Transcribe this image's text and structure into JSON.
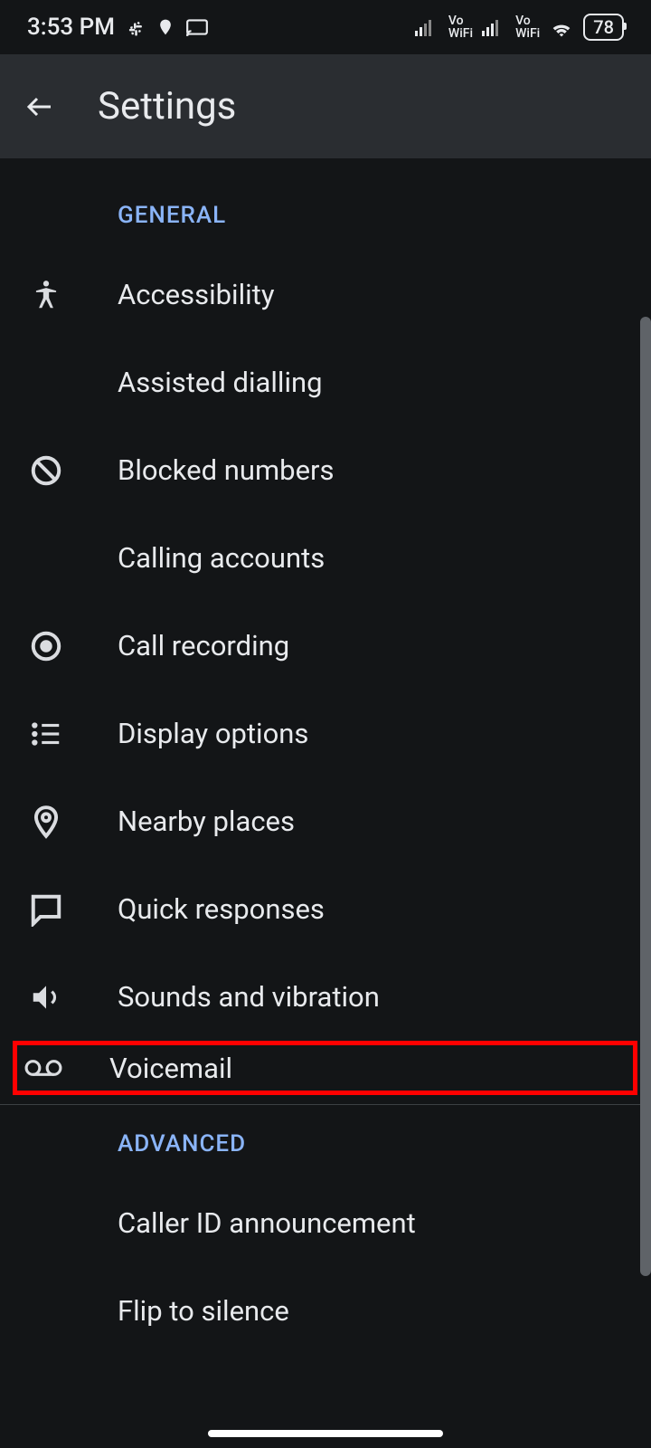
{
  "status_bar": {
    "time": "3:53 PM",
    "battery": "78",
    "vo_wifi_label": "Vo\nWiFi"
  },
  "app_bar": {
    "title": "Settings"
  },
  "sections": {
    "general": {
      "header": "GENERAL",
      "items": [
        {
          "label": "Accessibility",
          "icon": "accessibility"
        },
        {
          "label": "Assisted dialling",
          "icon": ""
        },
        {
          "label": "Blocked numbers",
          "icon": "block"
        },
        {
          "label": "Calling accounts",
          "icon": ""
        },
        {
          "label": "Call recording",
          "icon": "record"
        },
        {
          "label": "Display options",
          "icon": "list"
        },
        {
          "label": "Nearby places",
          "icon": "location"
        },
        {
          "label": "Quick responses",
          "icon": "chat"
        },
        {
          "label": "Sounds and vibration",
          "icon": "volume"
        },
        {
          "label": "Voicemail",
          "icon": "voicemail",
          "highlighted": true
        }
      ]
    },
    "advanced": {
      "header": "ADVANCED",
      "items": [
        {
          "label": "Caller ID announcement",
          "icon": ""
        },
        {
          "label": "Flip to silence",
          "icon": ""
        }
      ]
    }
  }
}
